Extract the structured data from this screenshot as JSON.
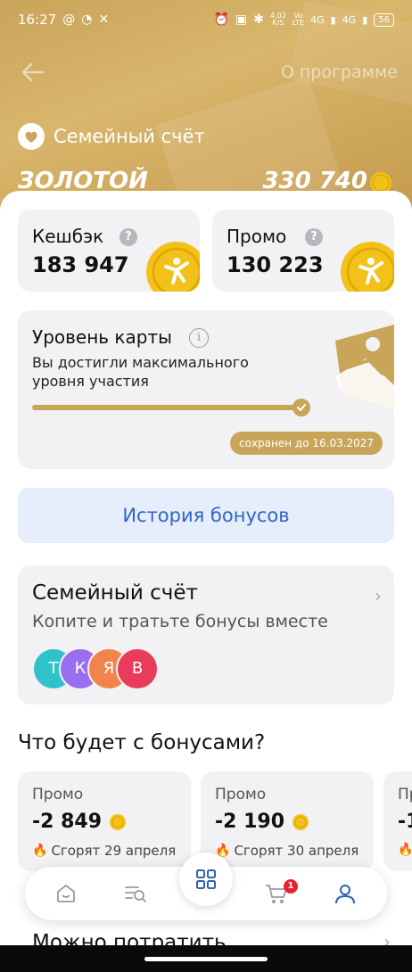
{
  "status_bar": {
    "time": "16:27",
    "net_speed_value": "4,02",
    "net_speed_unit": "K/S",
    "volte_top": "Vo",
    "volte_bottom": "LTE",
    "signal1": "4G",
    "signal2": "4G",
    "battery": "56"
  },
  "header": {
    "about_link": "О программе",
    "family_title": "Семейный счёт",
    "tier": "ЗОЛОТОЙ",
    "total_balance": "330 740"
  },
  "balances": {
    "cashback": {
      "label": "Кешбэк",
      "help": "?",
      "value": "183 947"
    },
    "promo": {
      "label": "Промо",
      "help": "?",
      "value": "130 223"
    }
  },
  "level": {
    "title": "Уровень карты",
    "info": "i",
    "description": "Вы достигли максимального уровня участия",
    "progress_fraction": 1.0,
    "saved_until": "сохранен до 16.03.2027"
  },
  "history_button": "История бонусов",
  "family_account": {
    "title": "Семейный счёт",
    "subtitle": "Копите и тратьте бонусы вместе",
    "members": [
      {
        "initial": "Т",
        "color": "#2fc3c9"
      },
      {
        "initial": "К",
        "color": "#9b6ef0"
      },
      {
        "initial": "Я",
        "color": "#f0844a"
      },
      {
        "initial": "В",
        "color": "#e83c5a"
      }
    ]
  },
  "burn_section": {
    "title": "Что будет с бонусами?",
    "items": [
      {
        "label": "Промо",
        "value": "-2 849",
        "date": "Сгорят 29 апреля"
      },
      {
        "label": "Промо",
        "value": "-2 190",
        "date": "Сгорят 30 апреля"
      },
      {
        "label": "Пр",
        "value": "-1",
        "date": ""
      }
    ]
  },
  "spend_section": {
    "title": "Можно потратить"
  },
  "nav": {
    "items": [
      "home-icon",
      "catalog-search-icon",
      "apps-grid-icon",
      "cart-icon",
      "profile-icon"
    ],
    "cart_badge": "1",
    "active_color": "#2f5fb8"
  },
  "colors": {
    "gold": "#c8a559",
    "accent_blue": "#2f64c8",
    "coin": "#f2c21b"
  }
}
